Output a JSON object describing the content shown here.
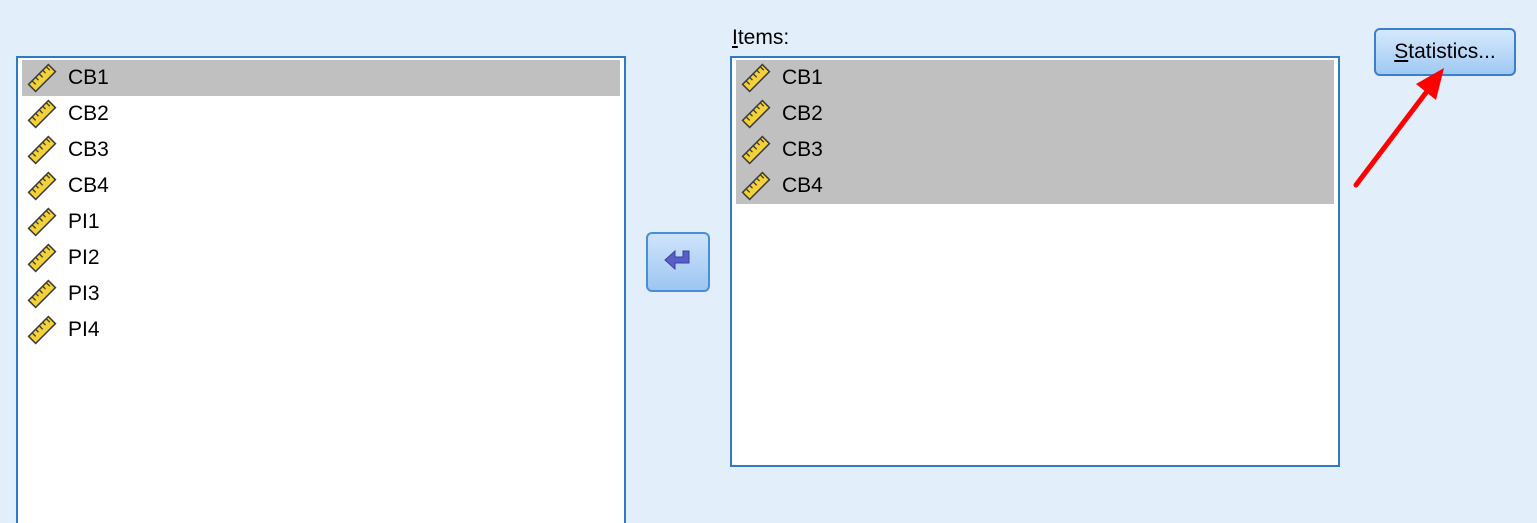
{
  "source_list": {
    "items": [
      {
        "label": "CB1",
        "icon": "scale-ruler-icon",
        "selected": true
      },
      {
        "label": "CB2",
        "icon": "scale-ruler-icon",
        "selected": false
      },
      {
        "label": "CB3",
        "icon": "scale-ruler-icon",
        "selected": false
      },
      {
        "label": "CB4",
        "icon": "scale-ruler-icon",
        "selected": false
      },
      {
        "label": "PI1",
        "icon": "scale-ruler-icon",
        "selected": false
      },
      {
        "label": "PI2",
        "icon": "scale-ruler-icon",
        "selected": false
      },
      {
        "label": "PI3",
        "icon": "scale-ruler-icon",
        "selected": false
      },
      {
        "label": "PI4",
        "icon": "scale-ruler-icon",
        "selected": false
      }
    ]
  },
  "items_panel": {
    "label_mnemonic": "I",
    "label_rest": "tems:",
    "items": [
      {
        "label": "CB1",
        "icon": "scale-ruler-icon",
        "selected": true
      },
      {
        "label": "CB2",
        "icon": "scale-ruler-icon",
        "selected": true
      },
      {
        "label": "CB3",
        "icon": "scale-ruler-icon",
        "selected": true
      },
      {
        "label": "CB4",
        "icon": "scale-ruler-icon",
        "selected": true
      }
    ]
  },
  "move_button": {
    "icon": "arrow-back-icon"
  },
  "statistics_button": {
    "mnemonic": "S",
    "rest": "tatistics..."
  },
  "annotation": {
    "icon": "red-arrow-icon",
    "color": "#ff0000"
  },
  "colors": {
    "background": "#e2eefa",
    "list_border": "#2f7ac4",
    "selection": "#c0c0c0"
  }
}
